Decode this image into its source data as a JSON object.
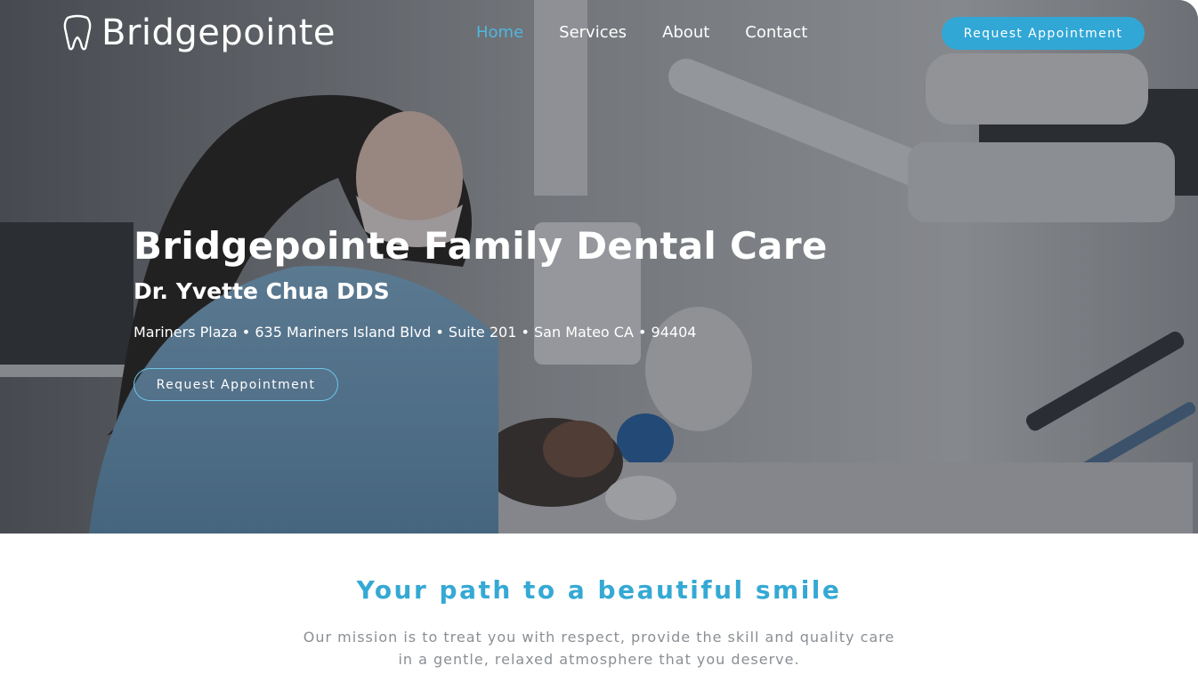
{
  "header": {
    "brand": "Bridgepointe",
    "nav": [
      {
        "label": "Home",
        "active": true
      },
      {
        "label": "Services",
        "active": false
      },
      {
        "label": "About",
        "active": false
      },
      {
        "label": "Contact",
        "active": false
      }
    ],
    "cta_label": "Request Appointment"
  },
  "hero": {
    "title": "Bridgepointe Family Dental Care",
    "subtitle": "Dr. Yvette Chua DDS",
    "address": "Mariners Plaza • 635 Mariners Island Blvd • Suite 201 • San Mateo CA • 94404",
    "cta_label": "Request Appointment",
    "image_description_icon": "dentist-photo"
  },
  "mission": {
    "heading": "Your path to a beautiful smile",
    "line1": "Our mission is to treat you with respect, provide the skill and quality care",
    "line2": "in a gentle, relaxed atmosphere that you deserve."
  },
  "colors": {
    "accent": "#31a7d6",
    "nav_active": "#4fb6df",
    "heading": "#35a9d4",
    "body_text": "#8a8f94"
  }
}
